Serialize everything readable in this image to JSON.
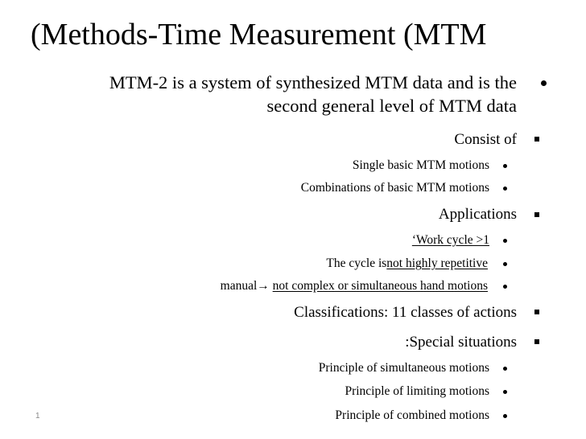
{
  "slide": {
    "title": "(Methods-Time Measurement (MTM",
    "slide_number": "1",
    "items": [
      {
        "level": 1,
        "bullet": "round-bullet",
        "lines": [
          "MTM-2 is a system of synthesized MTM data and is the",
          "second general level of MTM data"
        ]
      },
      {
        "level": 2,
        "bullet": "square-bullet",
        "text": "Consist of"
      },
      {
        "level": 3,
        "bullet": "round-bullet",
        "text": "Single basic MTM motions"
      },
      {
        "level": 3,
        "bullet": "round-bullet",
        "text": "Combinations of basic MTM motions"
      },
      {
        "level": 2,
        "bullet": "square-bullet",
        "text": "Applications"
      },
      {
        "level": 3,
        "bullet": "round-bullet",
        "underlined_text": "‘Work cycle >1"
      },
      {
        "level": 3,
        "bullet": "round-bullet",
        "plain_text": "The cycle is",
        "underlined_text": "not highly repetitive"
      },
      {
        "level": 3,
        "bullet": "round-bullet",
        "plain_text": "manual→ ",
        "underlined_text": "not complex or simultaneous hand motions"
      },
      {
        "level": 2,
        "bullet": "square-bullet",
        "text": "Classifications: 11 classes of actions"
      },
      {
        "level": 2,
        "bullet": "square-bullet",
        "text": ":Special situations"
      },
      {
        "level": 3,
        "bullet": "round-bullet",
        "text": "Principle of simultaneous motions"
      },
      {
        "level": 3,
        "bullet": "round-bullet",
        "text": "Principle of limiting motions"
      },
      {
        "level": 3,
        "bullet": "round-bullet",
        "text": "Principle of combined motions"
      }
    ]
  }
}
